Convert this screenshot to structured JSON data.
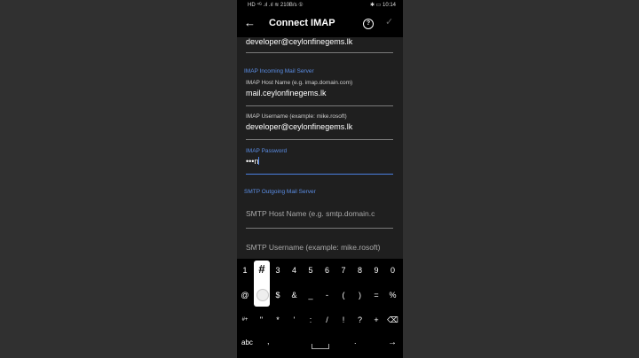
{
  "status": {
    "left_text": "HD ⁴ᴳ .ıl .ıl ≋ 210B/s ①",
    "right_text": "✱ ▭ 10:14"
  },
  "appbar": {
    "back_glyph": "←",
    "title": "Connect IMAP",
    "help_glyph": "?",
    "confirm_glyph": "✓"
  },
  "form": {
    "top_email": "developer@ceylonfinegems.lk",
    "incoming_section": "IMAP Incoming Mail Server",
    "host": {
      "label": "IMAP Host Name (e.g. imap.domain.com)",
      "value": "mail.ceylonfinegems.lk"
    },
    "username": {
      "label": "IMAP Username (example: mike.rosoft)",
      "value": "developer@ceylonfinegems.lk"
    },
    "password": {
      "label": "IMAP Password",
      "value": "•••n"
    },
    "outgoing_section": "SMTP Outgoing Mail Server",
    "smtp_host": {
      "placeholder": "SMTP Host Name (e.g. smtp.domain.c"
    },
    "smtp_username": {
      "placeholder": "SMTP Username (example: mike.rosoft)"
    }
  },
  "keyboard": {
    "row1": [
      "1",
      "#",
      "3",
      "4",
      "5",
      "6",
      "7",
      "8",
      "9",
      "0"
    ],
    "row2": [
      "@",
      "",
      "$",
      "&",
      "_",
      "-",
      "(",
      ")",
      "=",
      "%"
    ],
    "row3": [
      "#+",
      "\"",
      "*",
      "'",
      ":",
      "/",
      "!",
      "?",
      "+",
      "⌫"
    ],
    "popup_key": "#",
    "abc_label": "abc",
    "comma": ",",
    "period": ".",
    "enter_glyph": "→"
  }
}
